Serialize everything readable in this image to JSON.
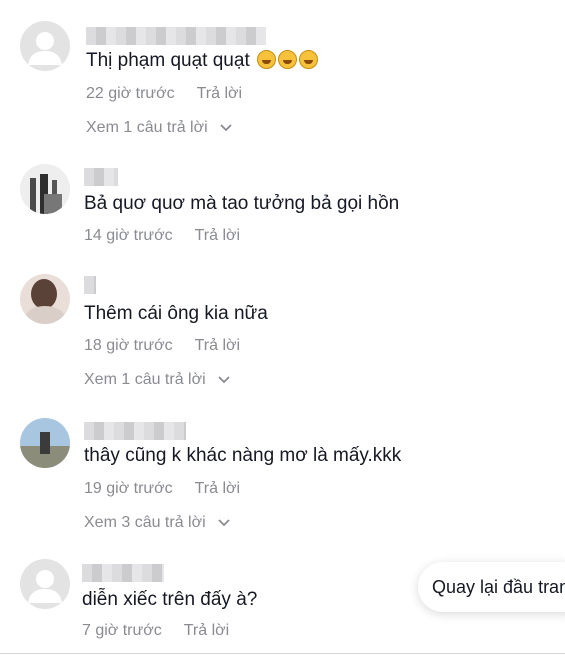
{
  "comments": [
    {
      "text": "Thị phạm quạt quạt",
      "emojis": [
        "rofl-emoji",
        "rofl-emoji",
        "rofl-emoji"
      ],
      "time": "22 giờ trước",
      "reply": "Trả lời",
      "view_replies": "Xem 1 câu trả lời",
      "avatar": "default-avatar"
    },
    {
      "text": "Bả quơ quơ mà tao tưởng bả gọi hồn",
      "time": "14 giờ trước",
      "reply": "Trả lời",
      "avatar": "photo-avatar"
    },
    {
      "text": "Thêm cái ông kia nữa",
      "time": "18 giờ trước",
      "reply": "Trả lời",
      "view_replies": "Xem 1 câu trả lời",
      "avatar": "photo-avatar"
    },
    {
      "text": "thây cũng k khác nàng mơ là mấy.kkk",
      "time": "19 giờ trước",
      "reply": "Trả lời",
      "view_replies": "Xem 3 câu trả lời",
      "avatar": "photo-avatar"
    },
    {
      "text": "diễn xiếc trên đấy à?",
      "time": "7 giờ trước",
      "reply": "Trả lời",
      "avatar": "default-avatar"
    }
  ],
  "back_to_top": "Quay lại đầu trang"
}
